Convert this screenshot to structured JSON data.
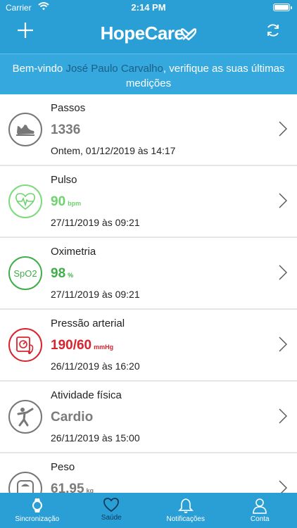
{
  "status_bar": {
    "carrier": "Carrier",
    "time": "2:14 PM"
  },
  "nav": {
    "logo": "HopeCare"
  },
  "welcome": {
    "prefix": "Bem-vindo",
    "name": "José Paulo Carvalho",
    "suffix": ", verifique as suas últimas medições"
  },
  "cards": [
    {
      "title": "Passos",
      "value": "1336",
      "unit": "",
      "date": "Ontem, 01/12/2019 às 14:17",
      "color": "#7b7b7b",
      "icon": "sneaker-icon"
    },
    {
      "title": "Pulso",
      "value": "90",
      "unit": "bpm",
      "date": "27/11/2019 às 09:21",
      "color": "#6dd36d",
      "icon": "heart-pulse-icon"
    },
    {
      "title": "Oximetria",
      "value": "98",
      "unit": "%",
      "date": "27/11/2019 às 09:21",
      "color": "#3fae4a",
      "icon": "spo2-icon",
      "icon_text": "SpO2"
    },
    {
      "title": "Pressão arterial",
      "value": "190/60",
      "unit": "mmHg",
      "date": "26/11/2019 às 16:20",
      "color": "#d9232e",
      "icon": "blood-pressure-icon"
    },
    {
      "title": "Atividade física",
      "value": "Cardio",
      "unit": "",
      "date": "26/11/2019 às 15:00",
      "color": "#7b7b7b",
      "icon": "stretching-person-icon"
    },
    {
      "title": "Peso",
      "value": "61,95",
      "unit": "kg",
      "date": "",
      "color": "#7b7b7b",
      "icon": "scale-icon"
    }
  ],
  "tabs": [
    {
      "label": "Sincronização",
      "icon": "watch-icon",
      "active": false
    },
    {
      "label": "Saúde",
      "icon": "heart-icon",
      "active": true
    },
    {
      "label": "Notificações",
      "icon": "bell-icon",
      "active": false
    },
    {
      "label": "Conta",
      "icon": "user-icon",
      "active": false
    }
  ]
}
